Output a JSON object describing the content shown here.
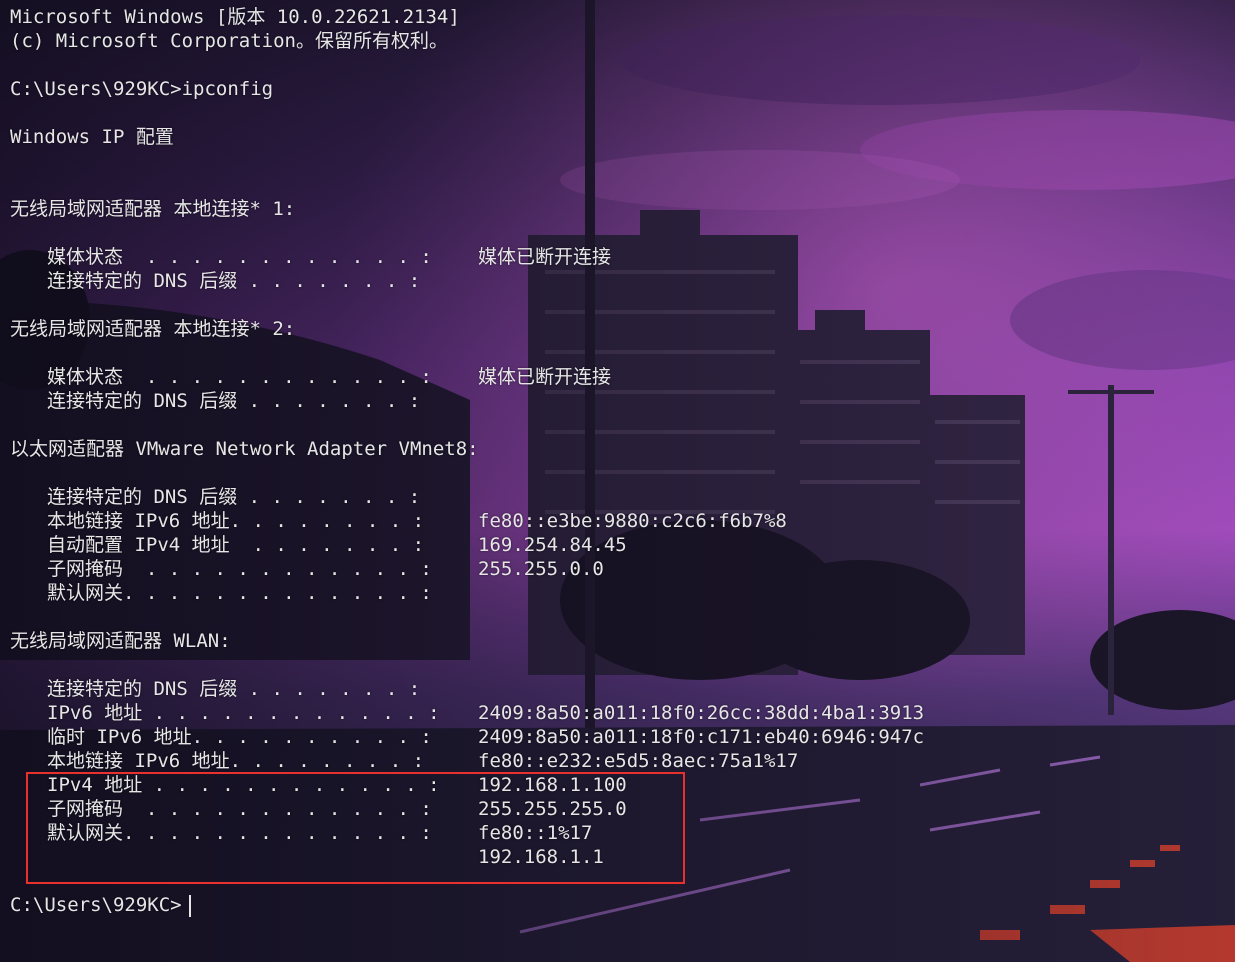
{
  "console": {
    "header": {
      "version": "Microsoft Windows [版本 10.0.22621.2134]",
      "copyright": "(c) Microsoft Corporation。保留所有权利。"
    },
    "command_line": "C:\\Users\\929KC>ipconfig",
    "title": "Windows IP 配置",
    "adapter1": {
      "heading": "无线局域网适配器 本地连接* 1:",
      "media_state_label": "媒体状态  . . . . . . . . . . . . :",
      "media_state_value": "媒体已断开连接",
      "dns_suffix_label": "连接特定的 DNS 后缀 . . . . . . . :"
    },
    "adapter2": {
      "heading": "无线局域网适配器 本地连接* 2:",
      "media_state_label": "媒体状态  . . . . . . . . . . . . :",
      "media_state_value": "媒体已断开连接",
      "dns_suffix_label": "连接特定的 DNS 后缀 . . . . . . . :"
    },
    "vmnet8": {
      "heading": "以太网适配器 VMware Network Adapter VMnet8:",
      "dns_suffix_label": "连接特定的 DNS 后缀 . . . . . . . :",
      "ipv6_link_label": "本地链接 IPv6 地址. . . . . . . . :",
      "ipv6_link_value": "fe80::e3be:9880:c2c6:f6b7%8",
      "autoconf_ipv4_label": "自动配置 IPv4 地址  . . . . . . . :",
      "autoconf_ipv4_value": "169.254.84.45",
      "subnet_label": "子网掩码  . . . . . . . . . . . . :",
      "subnet_value": "255.255.0.0",
      "gateway_label": "默认网关. . . . . . . . . . . . . :"
    },
    "wlan": {
      "heading": "无线局域网适配器 WLAN:",
      "dns_suffix_label": "连接特定的 DNS 后缀 . . . . . . . :",
      "ipv6_label": "IPv6 地址 . . . . . . . . . . . . :",
      "ipv6_value": "2409:8a50:a011:18f0:26cc:38dd:4ba1:3913",
      "temp_ipv6_label": "临时 IPv6 地址. . . . . . . . . . :",
      "temp_ipv6_value": "2409:8a50:a011:18f0:c171:eb40:6946:947c",
      "ipv6_link_label": "本地链接 IPv6 地址. . . . . . . . :",
      "ipv6_link_value": "fe80::e232:e5d5:8aec:75a1%17",
      "ipv4_label": "IPv4 地址 . . . . . . . . . . . . :",
      "ipv4_value": "192.168.1.100",
      "subnet_label": "子网掩码  . . . . . . . . . . . . :",
      "subnet_value": "255.255.255.0",
      "gateway_label": "默认网关. . . . . . . . . . . . . :",
      "gateway_value_1": "fe80::1%17",
      "gateway_value_2": "192.168.1.1"
    },
    "prompt": "C:\\Users\\929KC>"
  },
  "colors": {
    "text": "#e6e6e6",
    "highlight_border": "#e8312f",
    "sky_top": "#3a2550",
    "sky_mid": "#8a3fb0",
    "sky_glow": "#c85ad0",
    "road": "#2a2440"
  }
}
